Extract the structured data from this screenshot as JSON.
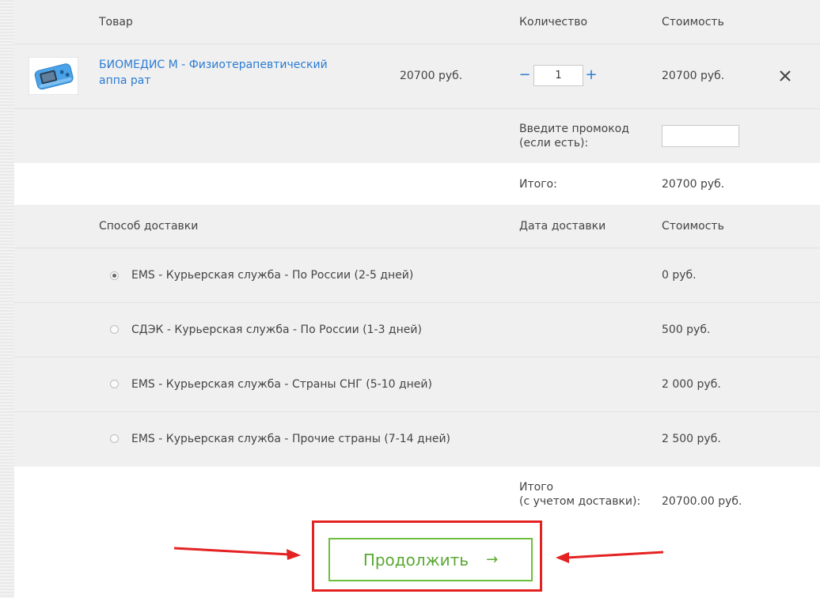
{
  "cart": {
    "header": {
      "product": "Товар",
      "quantity": "Количество",
      "cost": "Стоимость"
    },
    "item": {
      "name": "БИОМЕДИС М - Физиотерапевтический аппа рат",
      "price": "20700 руб.",
      "quantity": "1",
      "cost": "20700 руб.",
      "minus": "−",
      "plus": "+"
    },
    "promo": {
      "label_line1": "Введите промокод",
      "label_line2": "(если есть):",
      "value": ""
    },
    "total": {
      "label": "Итого:",
      "value": "20700 руб."
    }
  },
  "delivery": {
    "header": {
      "method": "Способ доставки",
      "date": "Дата доставки",
      "cost": "Стоимость"
    },
    "options": [
      {
        "label": "EMS - Курьерская служба - По России (2-5 дней)",
        "cost": "0 руб.",
        "selected": true
      },
      {
        "label": "СДЭК - Курьерская служба - По России (1-3 дней)",
        "cost": "500 руб.",
        "selected": false
      },
      {
        "label": "EMS - Курьерская служба - Страны СНГ (5-10 дней)",
        "cost": "2 000 руб.",
        "selected": false
      },
      {
        "label": "EMS - Курьерская служба - Прочие страны (7-14 дней)",
        "cost": "2 500 руб.",
        "selected": false
      }
    ]
  },
  "final": {
    "label_line1": "Итого",
    "label_line2": "(с учетом доставки):",
    "value": "20700.00 руб."
  },
  "continue_button": {
    "label": "Продолжить",
    "icon": "arrow-right-icon",
    "arrow_glyph": "→"
  },
  "colors": {
    "link": "#2a7bd4",
    "accent_green": "#6cbf3a",
    "highlight_red": "#e52222",
    "row_grey": "#f0f0f0"
  }
}
